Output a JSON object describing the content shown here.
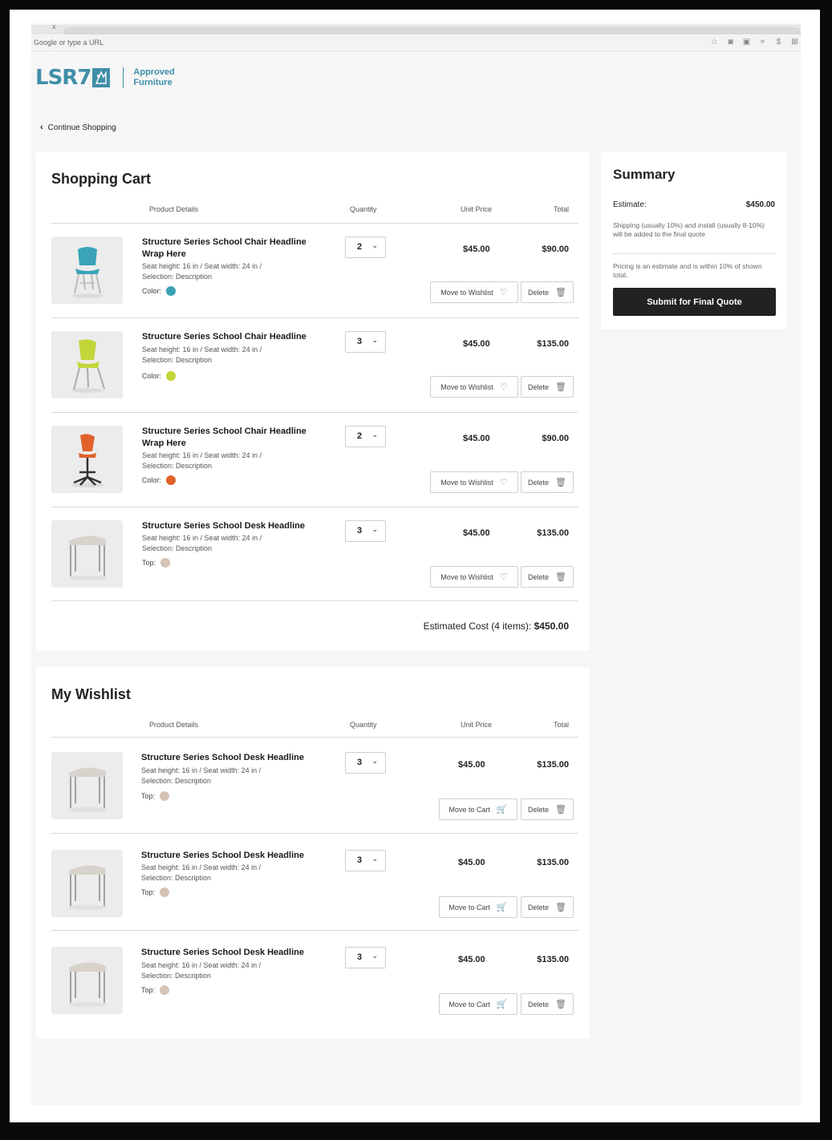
{
  "browser": {
    "tab_mark": "x",
    "url_placeholder": "Google or type a URL",
    "toolbar_icons": [
      "star-icon",
      "camera-icon",
      "extension-icon",
      "crop-icon",
      "dollar-icon",
      "close-icon"
    ],
    "toolbar_glyphs": [
      "☆",
      "◙",
      "▣",
      "⌗",
      "$",
      "⊠"
    ]
  },
  "brand": {
    "logo_text": "LSR7",
    "line1": "Approved",
    "line2": "Furniture",
    "color": "#3f8fa8"
  },
  "nav": {
    "continue_label": "Continue Shopping"
  },
  "columns": {
    "product": "Product Details",
    "quantity": "Quantity",
    "unit_price": "Unit Price",
    "total": "Total"
  },
  "cart": {
    "title": "Shopping Cart",
    "items": [
      {
        "name_line1": "Structure Series School Chair Headline",
        "name_line2": "Wrap Here",
        "spec1": "Seat height: 16 in / Seat width: 24 in /",
        "spec2": "Selection: Description",
        "attr_label": "Color:",
        "swatch": "#3aa3b6",
        "qty": "2",
        "unit_price": "$45.00",
        "total": "$90.00",
        "action_label": "Move to Wishlist",
        "delete_label": "Delete"
      },
      {
        "name_line1": "Structure Series School Chair Headline",
        "name_line2": "",
        "spec1": "Seat height: 16 in / Seat width: 24 in /",
        "spec2": "Selection: Description",
        "attr_label": "Color:",
        "swatch": "#c2d63a",
        "qty": "3",
        "unit_price": "$45.00",
        "total": "$135.00",
        "action_label": "Move to Wishlist",
        "delete_label": "Delete"
      },
      {
        "name_line1": "Structure Series School Chair Headline",
        "name_line2": "Wrap Here",
        "spec1": "Seat height: 16 in / Seat width: 24 in /",
        "spec2": "Selection: Description",
        "attr_label": "Color:",
        "swatch": "#e0622a",
        "qty": "2",
        "unit_price": "$45.00",
        "total": "$90.00",
        "action_label": "Move to Wishlist",
        "delete_label": "Delete"
      },
      {
        "name_line1": "Structure Series School Desk Headline",
        "name_line2": "",
        "spec1": "Seat height: 16 in / Seat width: 24 in /",
        "spec2": "Selection: Description",
        "attr_label": "Top:",
        "swatch": "#d6c3b6",
        "qty": "3",
        "unit_price": "$45.00",
        "total": "$135.00",
        "action_label": "Move to Wishlist",
        "delete_label": "Delete"
      }
    ],
    "estimated_label": "Estimated Cost (4 items):",
    "estimated_value": "$450.00"
  },
  "wishlist": {
    "title": "My Wishlist",
    "items": [
      {
        "name_line1": "Structure Series School Desk Headline",
        "spec1": "Seat height: 16 in / Seat width: 24 in /",
        "spec2": "Selection: Description",
        "attr_label": "Top:",
        "swatch": "#d6c3b6",
        "qty": "3",
        "unit_price": "$45.00",
        "total": "$135.00",
        "action_label": "Move to Cart",
        "delete_label": "Delete"
      },
      {
        "name_line1": "Structure Series School Desk Headline",
        "spec1": "Seat height: 16 in / Seat width: 24 in /",
        "spec2": "Selection: Description",
        "attr_label": "Top:",
        "swatch": "#d6c3b6",
        "qty": "3",
        "unit_price": "$45.00",
        "total": "$135.00",
        "action_label": "Move to Cart",
        "delete_label": "Delete"
      },
      {
        "name_line1": "Structure Series School Desk Headline",
        "spec1": "Seat height: 16 in / Seat width: 24 in /",
        "spec2": "Selection: Description",
        "attr_label": "Top:",
        "swatch": "#d6c3b6",
        "qty": "3",
        "unit_price": "$45.00",
        "total": "$135.00",
        "action_label": "Move to Cart",
        "delete_label": "Delete"
      }
    ]
  },
  "summary": {
    "title": "Summary",
    "estimate_label": "Estimate:",
    "estimate_value": "$450.00",
    "shipping_note": "Shipping (usually 10%) and install (usually 8-10%) will be added to the final quote",
    "pricing_note": "Pricing is an estimate and is within 10% of shown total.",
    "submit_label": "Submit for Final Quote"
  }
}
